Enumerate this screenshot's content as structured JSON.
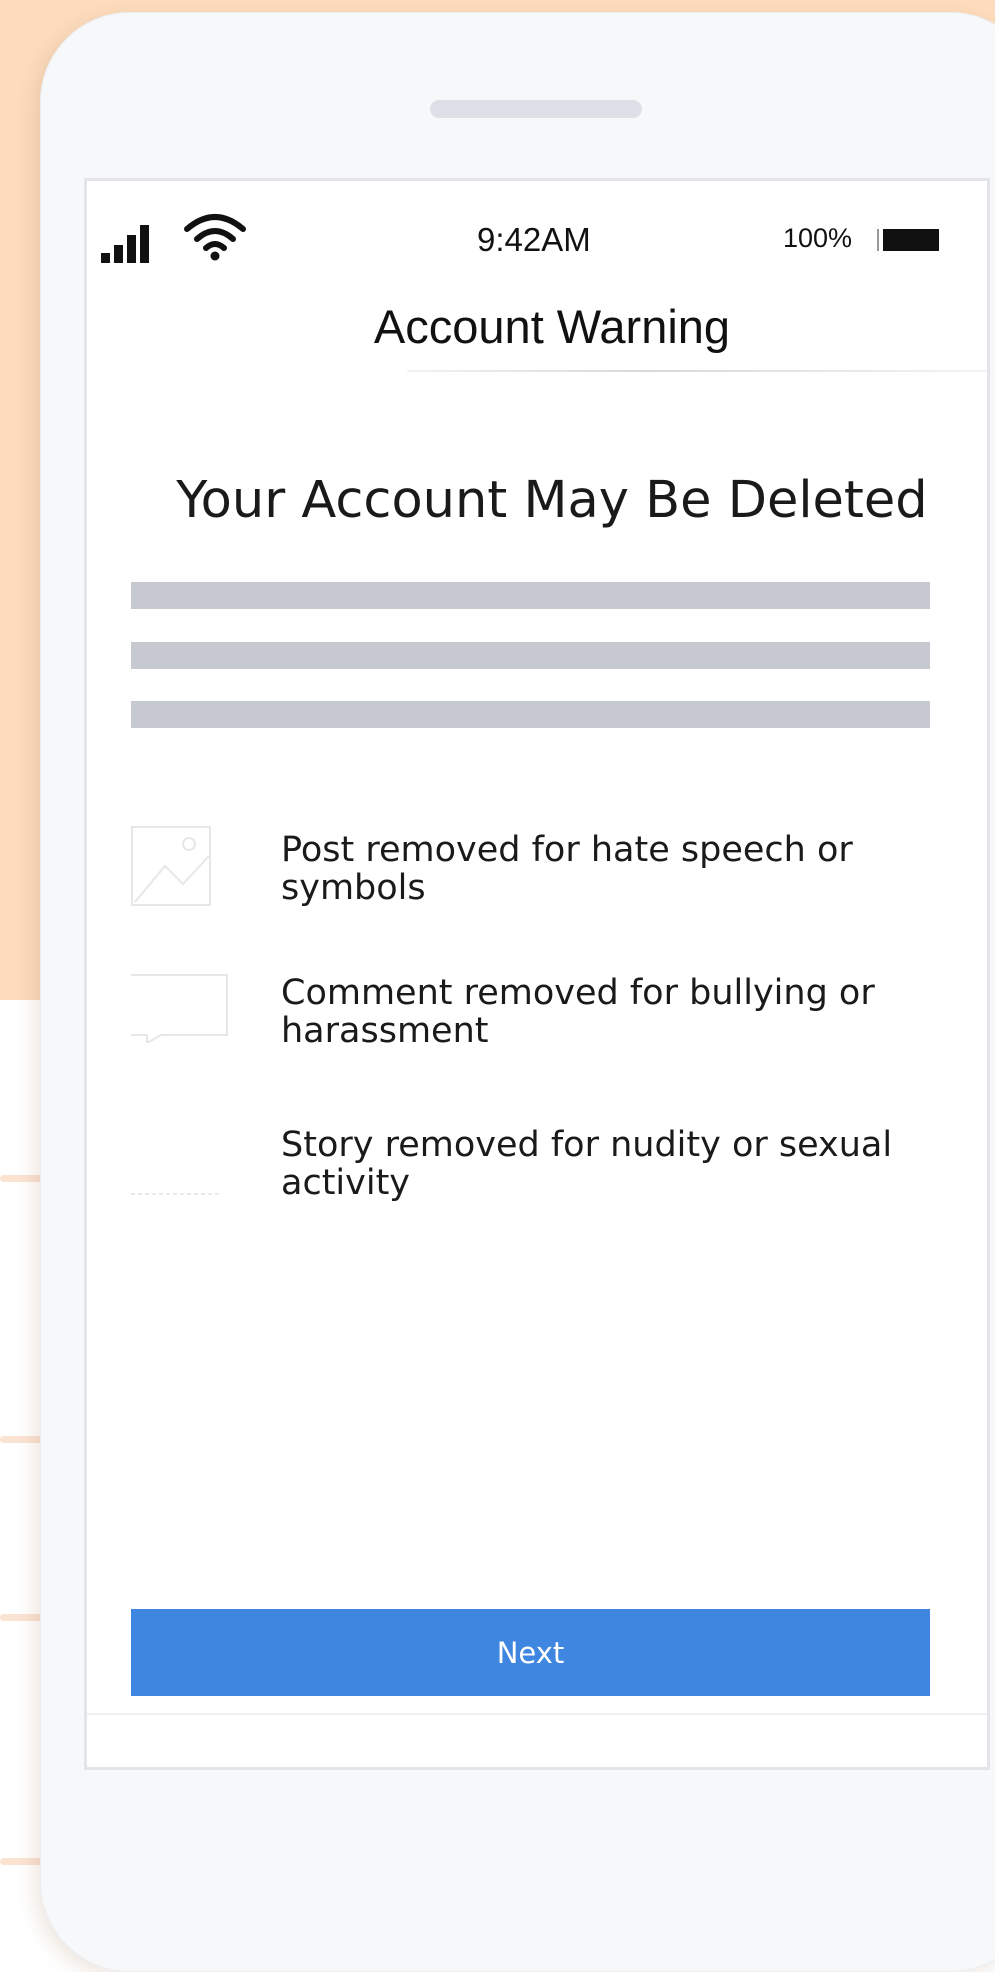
{
  "status_bar": {
    "time": "9:42AM",
    "battery": "100%",
    "icons": [
      "cellular-signal-icon",
      "wifi-icon",
      "battery-icon"
    ]
  },
  "nav": {
    "title": "Account Warning"
  },
  "headline": "Your Account May Be Deleted",
  "violations": [
    {
      "icon": "image-placeholder-icon",
      "text": "Post removed for hate speech or symbols"
    },
    {
      "icon": "comment-placeholder-icon",
      "text": "Comment removed for bullying or harassment"
    },
    {
      "icon": "story-placeholder-icon",
      "text": "Story removed for nudity or sexual activity"
    }
  ],
  "actions": {
    "next_label": "Next"
  },
  "colors": {
    "background": "#fcdcbd",
    "button": "#3f86e0",
    "placeholder_text_lines": "#c6c9d0"
  }
}
